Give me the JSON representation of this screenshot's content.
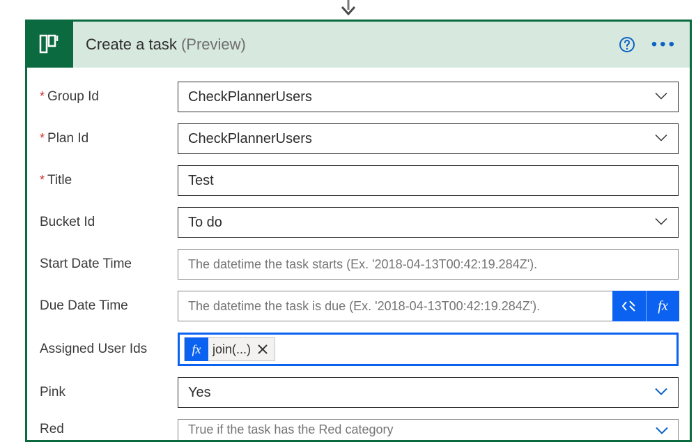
{
  "header": {
    "title": "Create a task",
    "suffix": "(Preview)"
  },
  "fields": {
    "groupId": {
      "label": "Group Id",
      "value": "CheckPlannerUsers"
    },
    "planId": {
      "label": "Plan Id",
      "value": "CheckPlannerUsers"
    },
    "title": {
      "label": "Title",
      "value": "Test"
    },
    "bucketId": {
      "label": "Bucket Id",
      "value": "To do"
    },
    "startDate": {
      "label": "Start Date Time",
      "placeholder": "The datetime the task starts (Ex. '2018-04-13T00:42:19.284Z')."
    },
    "dueDate": {
      "label": "Due Date Time",
      "placeholder": "The datetime the task is due (Ex. '2018-04-13T00:42:19.284Z')."
    },
    "assigned": {
      "label": "Assigned User Ids",
      "token": "join(...)"
    },
    "pink": {
      "label": "Pink",
      "value": "Yes"
    },
    "red": {
      "label": "Red",
      "placeholder": "True if the task has the Red category"
    }
  },
  "fx": "fx"
}
